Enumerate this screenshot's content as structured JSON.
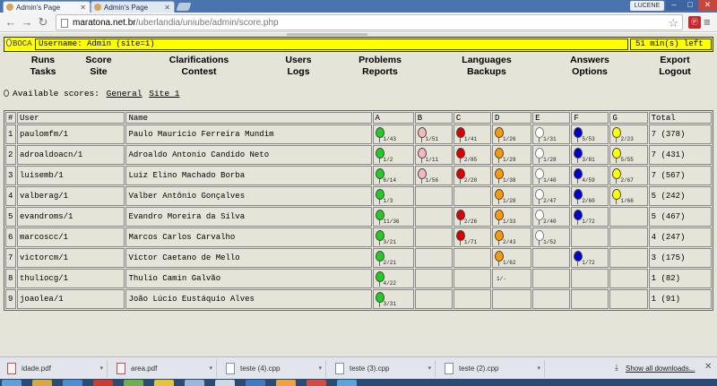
{
  "browser": {
    "tabs": [
      {
        "label": "Admin's Page",
        "active": true
      },
      {
        "label": "Admin's Page",
        "active": false
      }
    ],
    "user_badge": "LUCENE",
    "url_host": "maratona.net.br",
    "url_path": "/uberlandia/uniube/admin/score.php",
    "ext_icon": "Ⓟ",
    "window_controls": {
      "minimize": "–",
      "maximize": "□",
      "close": "✕"
    }
  },
  "infobar": {
    "logo": "BOCA",
    "username": "Username: Admin (site=1)",
    "time_left": "51 min(s) left"
  },
  "menu": {
    "col1": [
      "Runs",
      "Tasks"
    ],
    "col2": [
      "Score",
      "Site"
    ],
    "col3": [
      "Clarifications",
      "Contest"
    ],
    "col4": [
      "Users",
      "Logs"
    ],
    "col5": [
      "Problems",
      "Reports"
    ],
    "col6": [
      "Languages",
      "Backups"
    ],
    "col7": [
      "Answers",
      "Options"
    ],
    "col8": [
      "Export",
      "Logout"
    ]
  },
  "scores": {
    "label": "Available scores:",
    "links": [
      "General",
      "Site 1"
    ]
  },
  "table": {
    "headers": [
      "#",
      "User",
      "Name",
      "A",
      "B",
      "C",
      "D",
      "E",
      "F",
      "G",
      "Total"
    ],
    "problem_colors": {
      "A": "#22cc22",
      "B": "#f5b8c0",
      "C": "#dd0000",
      "D": "#ff9900",
      "E": "#ffffff",
      "F": "#0000cc",
      "G": "#ffff00"
    },
    "rows": [
      {
        "rank": "1",
        "user": "paulomfm/1",
        "name": "Paulo Mauricio Ferreira Mundim",
        "cells": {
          "A": "1/43",
          "B": "1/51",
          "C": "1/41",
          "D": "1/26",
          "E": "1/31",
          "F": "5/53",
          "G": "2/23"
        },
        "total": "7 (378)"
      },
      {
        "rank": "2",
        "user": "adroaldoacn/1",
        "name": "Adroaldo Antonio Candido Neto",
        "cells": {
          "A": "1/2",
          "B": "1/11",
          "C": "2/85",
          "D": "1/29",
          "E": "1/28",
          "F": "3/81",
          "G": "5/55"
        },
        "total": "7 (431)"
      },
      {
        "rank": "3",
        "user": "luisemb/1",
        "name": "Luiz Elino Machado Borba",
        "cells": {
          "A": "6/14",
          "B": "1/56",
          "C": "2/28",
          "D": "1/38",
          "E": "1/40",
          "F": "4/59",
          "G": "2/67"
        },
        "total": "7 (567)"
      },
      {
        "rank": "4",
        "user": "valberag/1",
        "name": "Valber Antônio Gonçalves",
        "cells": {
          "A": "1/3",
          "D": "1/28",
          "E": "2/47",
          "F": "2/60",
          "G": "1/66"
        },
        "total": "5 (242)"
      },
      {
        "rank": "5",
        "user": "evandroms/1",
        "name": "Evandro Moreira da Silva",
        "cells": {
          "A": "11/36",
          "C": "2/26",
          "D": "1/33",
          "E": "2/40",
          "F": "1/72"
        },
        "total": "5 (467)"
      },
      {
        "rank": "6",
        "user": "marcoscc/1",
        "name": "Marcos Carlos Carvalho",
        "cells": {
          "A": "3/21",
          "C": "1/71",
          "D": "2/43",
          "E": "1/52"
        },
        "total": "4 (247)"
      },
      {
        "rank": "7",
        "user": "victorcm/1",
        "name": "Victor Caetano de Mello",
        "cells": {
          "A": "2/21",
          "D": "1/62",
          "F": "1/72"
        },
        "total": "3 (175)"
      },
      {
        "rank": "8",
        "user": "thuliocg/1",
        "name": "Thulio Camin Galvão",
        "cells": {
          "A": "4/22"
        },
        "plain": {
          "D": "1/-"
        },
        "total": "1 (82)"
      },
      {
        "rank": "9",
        "user": "joaolea/1",
        "name": "João Lúcio Eustáquio Alves",
        "cells": {
          "A": "3/31"
        },
        "total": "1 (91)"
      }
    ]
  },
  "downloads": {
    "items": [
      "idade.pdf",
      "area.pdf",
      "teste (4).cpp",
      "teste (3).cpp",
      "teste (2).cpp"
    ],
    "show_all": "Show all downloads...",
    "close": "✕"
  }
}
